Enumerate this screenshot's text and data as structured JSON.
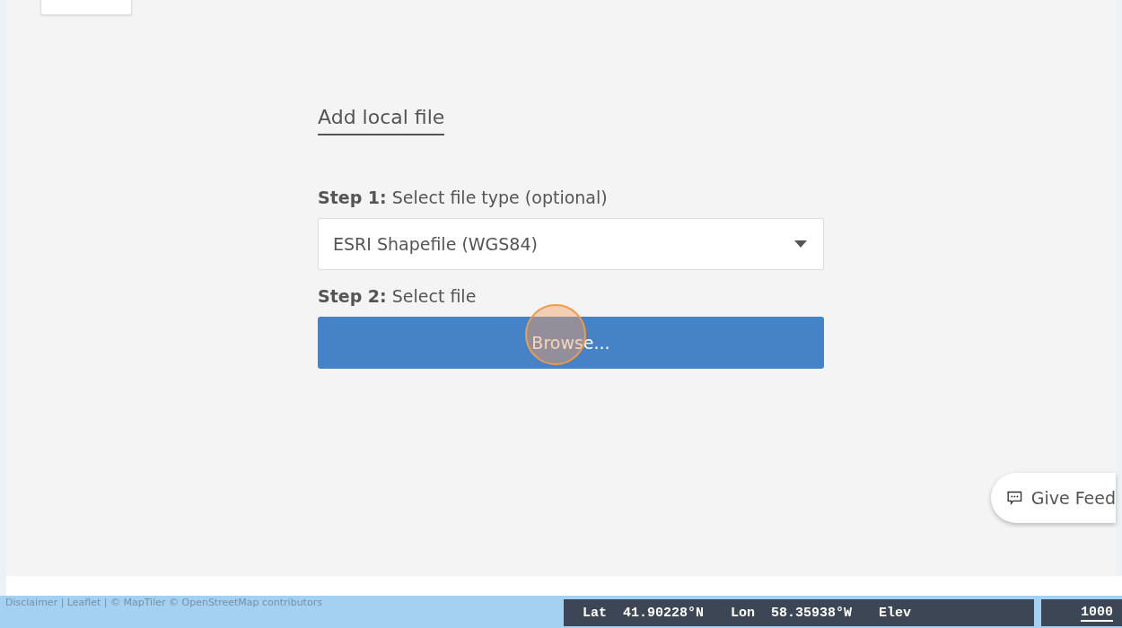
{
  "panel": {
    "title": "Add local file",
    "step1": {
      "label": "**Step 1:** Select file type (optional)"
    },
    "file_type": {
      "value": "ESRI Shapefile (WGS84)",
      "expanded": false
    },
    "step2": {
      "label": "**Step 2:** Select file"
    },
    "browse_button": {
      "label": "Browse...",
      "highlighted": true
    }
  },
  "feedback_button": {
    "label": "Give Feed"
  },
  "attribution": "Disclaimer | Leaflet | © MapTiler © OpenStreetMap contributors",
  "status_bar": {
    "lat_label": "Lat",
    "lat": "41.90228°N",
    "lon_label": "Lon",
    "lon": "58.35938°W",
    "elev_label": "Elev",
    "scale": "1000"
  }
}
